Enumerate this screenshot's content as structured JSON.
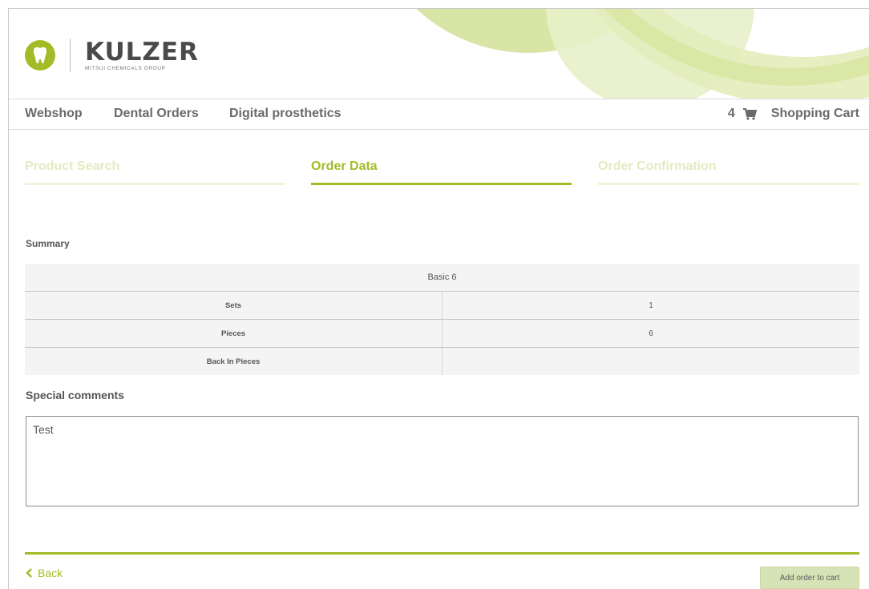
{
  "brand": {
    "name": "KULZER",
    "subtitle": "MITSUI CHEMICALS GROUP",
    "accent_color": "#a2bc27"
  },
  "nav": {
    "items": [
      {
        "label": "Webshop"
      },
      {
        "label": "Dental Orders"
      },
      {
        "label": "Digital prosthetics"
      }
    ],
    "cart": {
      "count": "4",
      "label": "Shopping Cart",
      "icon": "shopping-cart-icon"
    }
  },
  "steps": [
    {
      "label": "Product Search",
      "state": "inactive"
    },
    {
      "label": "Order Data",
      "state": "active"
    },
    {
      "label": "Order Confirmation",
      "state": "inactive"
    }
  ],
  "summary": {
    "title": "Summary",
    "header": "Basic 6",
    "rows": [
      {
        "label": "Sets",
        "value": "1"
      },
      {
        "label": "Pieces",
        "value": "6"
      },
      {
        "label": "Back In Pieces",
        "value": ""
      }
    ]
  },
  "comments": {
    "title": "Special comments",
    "value": "Test"
  },
  "footer": {
    "back_label": "Back",
    "add_label": "Add order to cart"
  }
}
